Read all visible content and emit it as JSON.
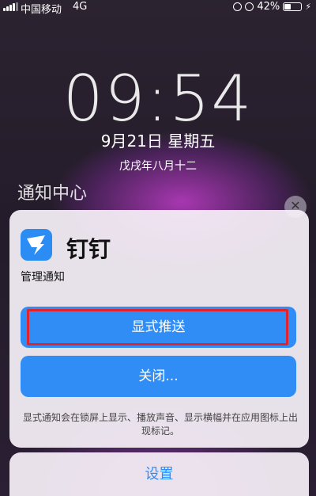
{
  "status_bar": {
    "carrier": "中国移动",
    "network": "4G",
    "battery": "42%",
    "battery_level": 0.42
  },
  "lock_screen": {
    "time": "09:54",
    "date": "9月21日 星期五",
    "lunar_date": "戊戌年八月十二"
  },
  "notification_center": {
    "title": "通知中心",
    "close_glyph": "✕"
  },
  "action_sheet": {
    "app_name": "钉钉",
    "subtitle": "管理通知",
    "buttons": {
      "show_push": "显式推送",
      "close": "关闭..."
    },
    "description": "显式通知会在锁屏上显示、播放声音、显示横幅并在应用图标上出现标记。",
    "settings": "设置"
  },
  "colors": {
    "accent": "#2f8df5",
    "highlight_border": "#e0242e",
    "app_icon": "#2b8cf3"
  },
  "icons": {
    "app": "dingtalk-icon",
    "status": [
      "signal-icon",
      "lock-rotation-icon",
      "alarm-icon",
      "battery-icon",
      "charging-icon"
    ]
  }
}
